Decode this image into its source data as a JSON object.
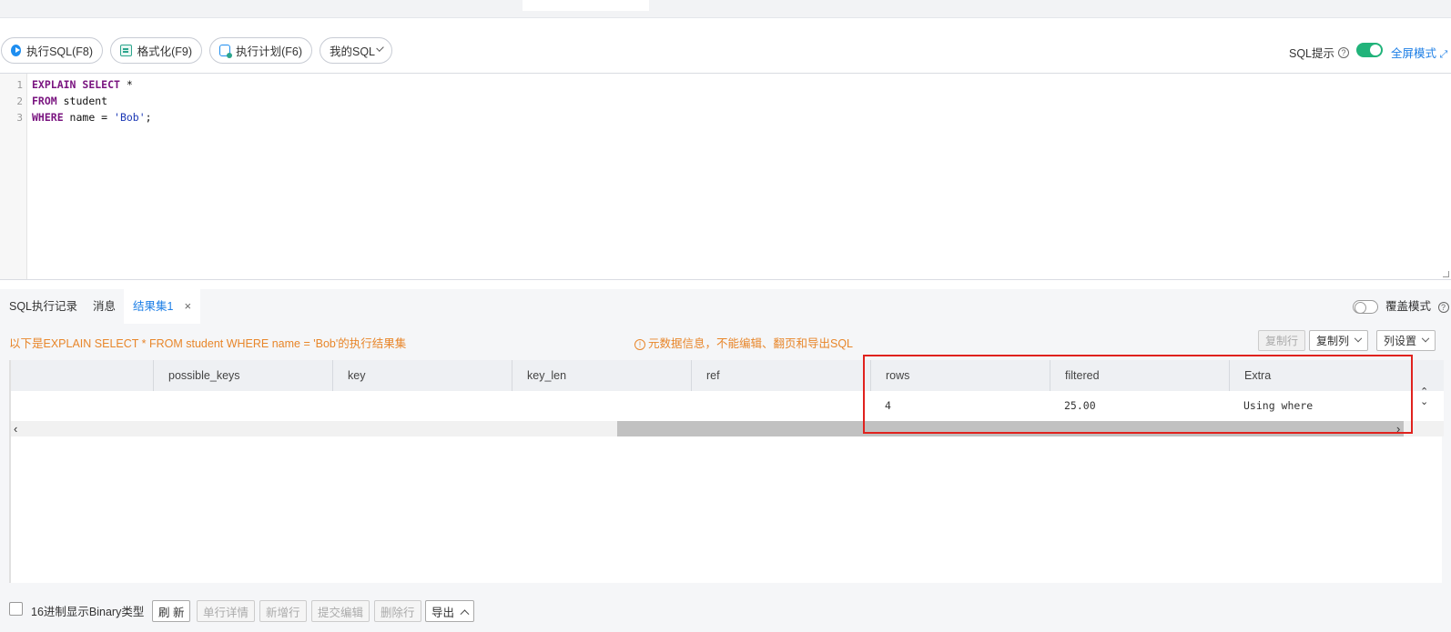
{
  "toolbar": {
    "run_sql": "执行SQL(F8)",
    "format": "格式化(F9)",
    "explain": "执行计划(F6)",
    "my_sql": "我的SQL",
    "sql_hint": "SQL提示",
    "sql_hint_enabled": true,
    "fullscreen": "全屏模式"
  },
  "editor": {
    "lines": [
      {
        "num": "1",
        "kw1": "EXPLAIN",
        "kw2": "SELECT",
        "rest": " *"
      },
      {
        "num": "2",
        "kw1": "FROM",
        "rest": " student"
      },
      {
        "num": "3",
        "kw1": "WHERE",
        "rest": " name = ",
        "str": "'Bob'",
        "end": ";"
      }
    ]
  },
  "result_tabs": {
    "history": "SQL执行记录",
    "messages": "消息",
    "resultset": "结果集1",
    "close": "×",
    "cover_mode": "覆盖模式",
    "cover_mode_enabled": false
  },
  "result": {
    "message": "以下是EXPLAIN SELECT * FROM student WHERE name = 'Bob'的执行结果集",
    "meta_notice": "元数据信息，不能编辑、翻页和导出SQL",
    "copy_row": "复制行",
    "copy_col": "复制列",
    "col_settings": "列设置",
    "columns": [
      "possible_keys",
      "key",
      "key_len",
      "ref",
      "rows",
      "filtered",
      "Extra"
    ],
    "row": {
      "rows": "4",
      "filtered": "25.00",
      "Extra": "Using where"
    }
  },
  "footer": {
    "hex_binary": "16进制显示Binary类型",
    "refresh": "刷 新",
    "row_detail": "单行详情",
    "add_row": "新增行",
    "submit_edit": "提交编辑",
    "delete_row": "删除行",
    "export": "导出"
  },
  "colors": {
    "accent": "#1e7fe6",
    "warning": "#e8862a",
    "toggle_on": "#21b37a",
    "highlight": "#e0221e"
  }
}
